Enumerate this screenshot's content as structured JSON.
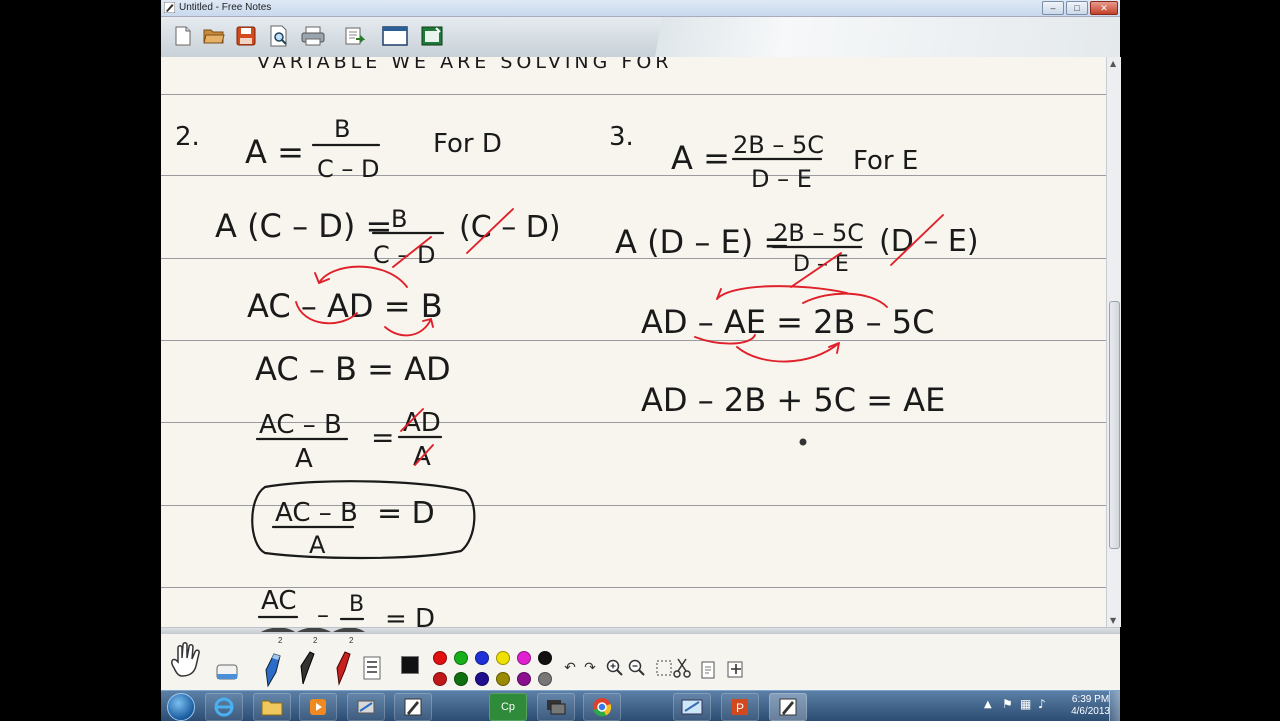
{
  "window": {
    "title": "Untitled - Free Notes",
    "buttons": {
      "minimize": "–",
      "maximize": "□",
      "close": "✕"
    }
  },
  "toolbar": {
    "items": [
      "new-document-icon",
      "open-folder-icon",
      "save-icon",
      "print-preview-icon",
      "print-icon",
      "export-icon",
      "fullscreen-icon",
      "presentation-icon"
    ]
  },
  "notes": {
    "header_fragment": "VARIABLE WE ARE SOLVING FOR",
    "problem2": {
      "number": "2.",
      "lhs": "A =",
      "numerator": "B",
      "denominator": "C – D",
      "for_label": "For D",
      "step1_lhs": "A (C – D) =",
      "step1_num": "B",
      "step1_den": "C – D",
      "step1_mult": "(C – D)",
      "step2": "AC – AD = B",
      "step3": "AC – B = AD",
      "step4_num": "AC – B",
      "step4_den": "A",
      "step4_eq": "=",
      "step4_rnum": "AD",
      "step4_rden": "A",
      "answer_num": "AC – B",
      "answer_den": "A",
      "answer_rhs": "= D",
      "alt_num1": "AC",
      "alt_minus": "–",
      "alt_num2": "B",
      "alt_rhs": "= D"
    },
    "problem3": {
      "number": "3.",
      "lhs": "A =",
      "numerator": "2B – 5C",
      "denominator": "D – E",
      "for_label": "For E",
      "step1_lhs": "A (D – E) =",
      "step1_num": "2B – 5C",
      "step1_den": "D – E",
      "step1_mult": "(D – E)",
      "step2": "AD – AE = 2B – 5C",
      "step3": "AD – 2B + 5C = AE"
    }
  },
  "palette": {
    "colors": [
      "#e01010",
      "#18b018",
      "#2030d8",
      "#f0e000",
      "#e020d0",
      "#111111",
      "#c01818",
      "#107010",
      "#201090",
      "#9a8a00",
      "#8a1090",
      "#777777"
    ],
    "line_widths_label": "2"
  },
  "taskbar": {
    "apps": [
      "ie-icon",
      "folder-icon",
      "media-icon",
      "tool-icon",
      "freenotes-icon",
      "cp-icon",
      "network-icon",
      "chrome-icon",
      "paint-icon",
      "powerpoint-icon",
      "freenotes-active-icon"
    ],
    "cp_label": "Cp",
    "clock_time": "6:39 PM",
    "clock_date": "4/6/2013"
  }
}
